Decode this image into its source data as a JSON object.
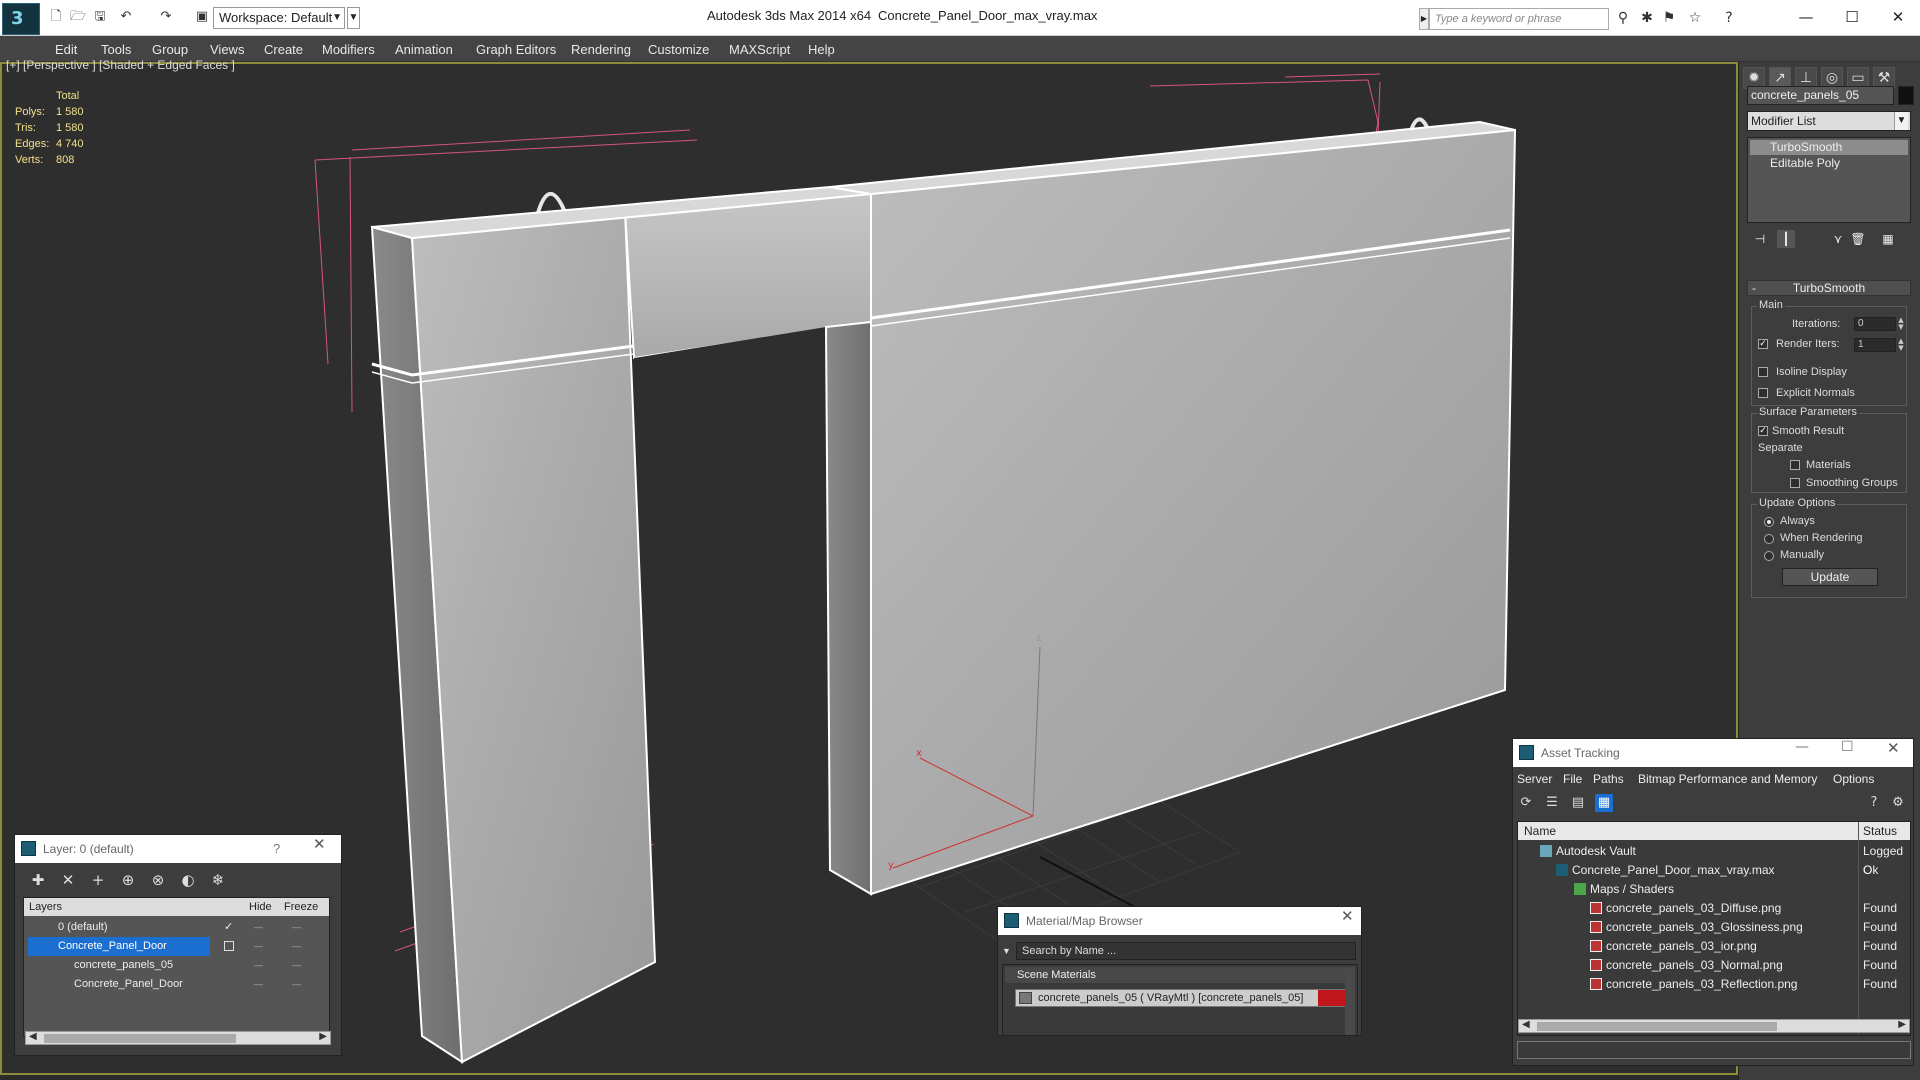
{
  "titlebar": {
    "app": "Autodesk 3ds Max  2014 x64",
    "file": "Concrete_Panel_Door_max_vray.max",
    "workspace": "Workspace: Default",
    "search_placeholder": "Type a keyword or phrase"
  },
  "menu": [
    "Edit",
    "Tools",
    "Group",
    "Views",
    "Create",
    "Modifiers",
    "Animation",
    "Graph Editors",
    "Rendering",
    "Customize",
    "MAXScript",
    "Help"
  ],
  "viewport": {
    "label": "[+] [Perspective ] [Shaded + Edged Faces ]",
    "stats": {
      "header": "Total",
      "rows": [
        {
          "label": "Polys:",
          "value": "1 580"
        },
        {
          "label": "Tris:",
          "value": "1 580"
        },
        {
          "label": "Edges:",
          "value": "4 740"
        },
        {
          "label": "Verts:",
          "value": "808"
        }
      ]
    },
    "axes": {
      "x": "x",
      "y": "y",
      "z": "z"
    }
  },
  "command_panel": {
    "object_name": "concrete_panels_05",
    "modifier_list": "Modifier List",
    "stack": [
      "TurboSmooth",
      "Editable Poly"
    ],
    "rollout": "TurboSmooth",
    "main": {
      "title": "Main",
      "iterations_label": "Iterations:",
      "iterations_value": "0",
      "render_iters_label": "Render Iters:",
      "render_iters_value": "1",
      "isoline": "Isoline Display",
      "explicit_normals": "Explicit Normals"
    },
    "surface": {
      "title": "Surface Parameters",
      "smooth_result": "Smooth Result",
      "separate": "Separate",
      "materials": "Materials",
      "smoothing_groups": "Smoothing Groups"
    },
    "update": {
      "title": "Update Options",
      "always": "Always",
      "when_rendering": "When Rendering",
      "manually": "Manually",
      "button": "Update"
    }
  },
  "layer_panel": {
    "title": "Layer: 0 (default)",
    "help": "?",
    "columns": [
      "Layers",
      "Hide",
      "Freeze"
    ],
    "rows": [
      {
        "name": "0 (default)"
      },
      {
        "name": "Concrete_Panel_Door"
      },
      {
        "name": "concrete_panels_05"
      },
      {
        "name": "Concrete_Panel_Door"
      }
    ]
  },
  "material_browser": {
    "title": "Material/Map Browser",
    "search_placeholder": "Search by Name ...",
    "section": "Scene Materials",
    "item": "concrete_panels_05  ( VRayMtl ) [concrete_panels_05]"
  },
  "asset_tracking": {
    "title": "Asset Tracking",
    "menu": [
      "Server",
      "File",
      "Paths",
      "Bitmap Performance and Memory",
      "Options"
    ],
    "columns": [
      "Name",
      "Status"
    ],
    "rows": [
      {
        "name": "Autodesk Vault",
        "status": "Logged O"
      },
      {
        "name": "Concrete_Panel_Door_max_vray.max",
        "status": "Ok"
      },
      {
        "name": "Maps / Shaders",
        "status": ""
      },
      {
        "name": "concrete_panels_03_Diffuse.png",
        "status": "Found"
      },
      {
        "name": "concrete_panels_03_Glossiness.png",
        "status": "Found"
      },
      {
        "name": "concrete_panels_03_ior.png",
        "status": "Found"
      },
      {
        "name": "concrete_panels_03_Normal.png",
        "status": "Found"
      },
      {
        "name": "concrete_panels_03_Reflection.png",
        "status": "Found"
      }
    ]
  },
  "colors": {
    "accent_red": "#c0151a",
    "selection_blue": "#1a6fd1",
    "stats_yellow": "#f2e08a"
  }
}
